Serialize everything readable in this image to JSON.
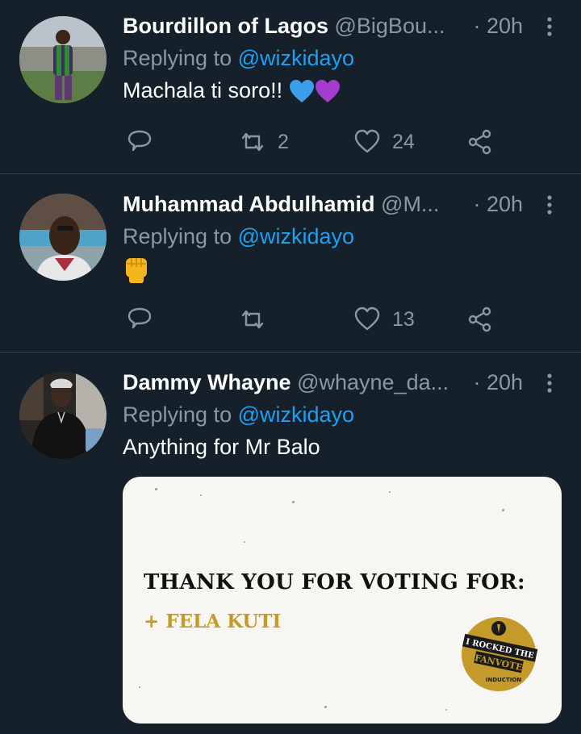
{
  "colors": {
    "background": "#15202b",
    "divider": "#38444d",
    "secondary_text": "#8899a6",
    "mention": "#1da1f2",
    "media_bg": "#f7f6f3",
    "gold": "#c49a2a"
  },
  "tweets": [
    {
      "name": "Bourdillon of Lagos",
      "handle": "@BigBou...",
      "time": "· 20h",
      "reply_prefix": "Replying to ",
      "reply_to": "@wizkidayo",
      "text": "Machala ti soro!!",
      "emojis": [
        "blue-heart-icon",
        "purple-heart-icon"
      ],
      "retweets": "2",
      "likes": "24"
    },
    {
      "name": "Muhammad Abdulhamid",
      "handle": "@M...",
      "time": "· 20h",
      "reply_prefix": "Replying to ",
      "reply_to": "@wizkidayo",
      "text": "",
      "emojis": [
        "raised-fist-icon"
      ],
      "retweets": "",
      "likes": "13"
    },
    {
      "name": "Dammy Whayne",
      "handle": "@whayne_da...",
      "time": "· 20h",
      "reply_prefix": "Replying to ",
      "reply_to": "@wizkidayo",
      "text": "Anything for Mr Balo",
      "media": {
        "headline": "THANK YOU FOR VOTING FOR:",
        "name": "+ FELA KUTI",
        "badge_line1": "I ROCKED THE",
        "badge_line2": "FANVOTE",
        "badge_line3": "INDUCTION"
      }
    }
  ]
}
